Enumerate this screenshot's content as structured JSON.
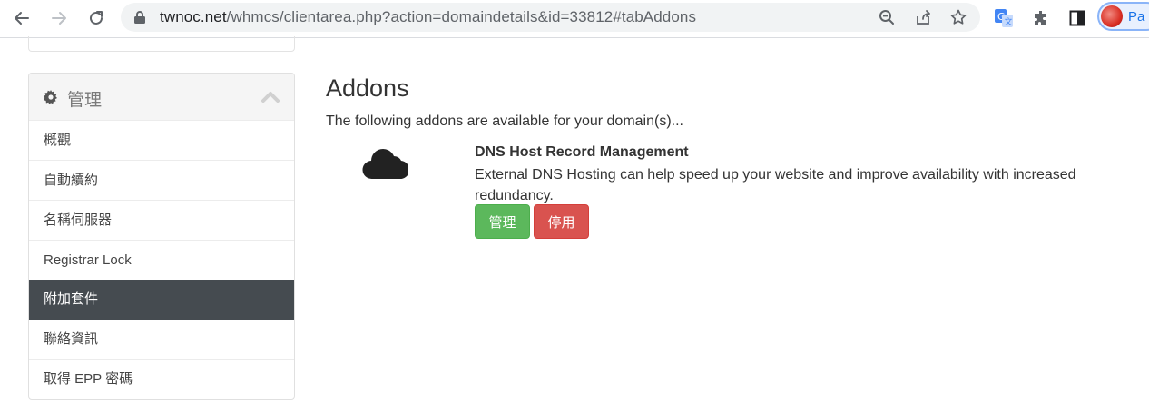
{
  "browser": {
    "url_host": "twnoc.net",
    "url_path": "/whmcs/clientarea.php?action=domaindetails&id=33812#tabAddons",
    "profile_label": "Pa",
    "icons": [
      "back-icon",
      "forward-icon",
      "reload-icon",
      "lock-icon",
      "zoom-icon",
      "share-icon",
      "star-icon",
      "translate-icon",
      "extensions-icon",
      "side-panel-icon"
    ]
  },
  "sidebar": {
    "title": "管理",
    "items": [
      {
        "label": "概觀",
        "active": false
      },
      {
        "label": "自動續約",
        "active": false
      },
      {
        "label": "名稱伺服器",
        "active": false
      },
      {
        "label": "Registrar Lock",
        "active": false
      },
      {
        "label": "附加套件",
        "active": true
      },
      {
        "label": "聯絡資訊",
        "active": false
      },
      {
        "label": "取得 EPP 密碼",
        "active": false
      }
    ]
  },
  "main": {
    "title": "Addons",
    "description": "The following addons are available for your domain(s)...",
    "addon": {
      "name": "DNS Host Record Management",
      "description": "External DNS Hosting can help speed up your website and improve availability with increased redundancy.",
      "manage_label": "管理",
      "disable_label": "停用"
    }
  },
  "colors": {
    "active_item_bg": "#454b50",
    "manage_button": "#5cb85c",
    "disable_button": "#d9534f"
  }
}
